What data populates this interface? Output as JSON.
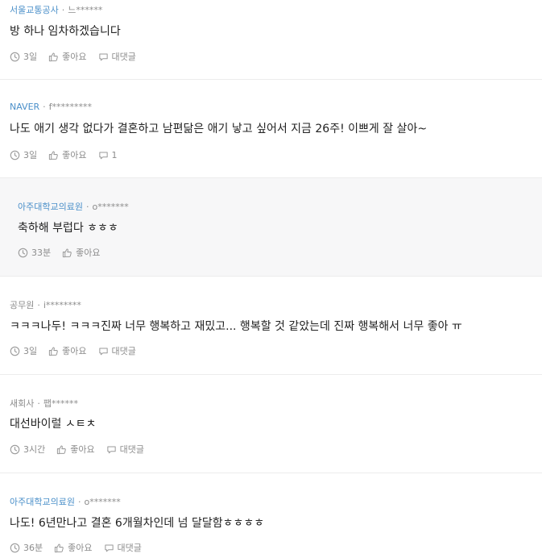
{
  "comments": [
    {
      "company": "서울교통공사",
      "user": "느******",
      "text": "방 하나 임차하겠습니다",
      "time": "3일",
      "like_label": "좋아요",
      "reply_label": "대댓글"
    },
    {
      "company": "NAVER",
      "user": "f*********",
      "text": "나도 애기 생각 없다가 결혼하고 남편닮은 애기 낳고 싶어서 지금 26주! 이쁘게 잘 살아~",
      "time": "3일",
      "like_label": "좋아요",
      "reply_label": "1"
    },
    {
      "company": "아주대학교의료원",
      "user": "o*******",
      "text": "축하해 부럽다 ㅎㅎㅎ",
      "time": "33분",
      "like_label": "좋아요"
    },
    {
      "company": "공무원",
      "user": "i********",
      "text": "ㅋㅋㅋ나두! ㅋㅋㅋ진짜 너무 행복하고 재밌고... 행복할 것 같았는데 진짜 행복해서 너무 좋아 ㅠ",
      "time": "3일",
      "like_label": "좋아요",
      "reply_label": "대댓글"
    },
    {
      "company": "새회사",
      "user": "팹******",
      "text": "대선바이럴 ㅅㅌㅊ",
      "time": "3시간",
      "like_label": "좋아요",
      "reply_label": "대댓글"
    },
    {
      "company": "아주대학교의료원",
      "user": "o*******",
      "text": "나도! 6년만나고 결혼 6개월차인데 넘 달달함ㅎㅎㅎㅎ",
      "time": "36분",
      "like_label": "좋아요",
      "reply_label": "대댓글"
    }
  ],
  "separator": "·",
  "colors": {
    "company_link": "#4a8fc9",
    "meta": "#8c8c8c",
    "text": "#222222",
    "reply_bg": "#f7f7f8",
    "divider": "#ececec"
  },
  "icons": {
    "time": "clock-icon",
    "like": "thumbs-up-icon",
    "reply": "speech-bubble-icon"
  }
}
